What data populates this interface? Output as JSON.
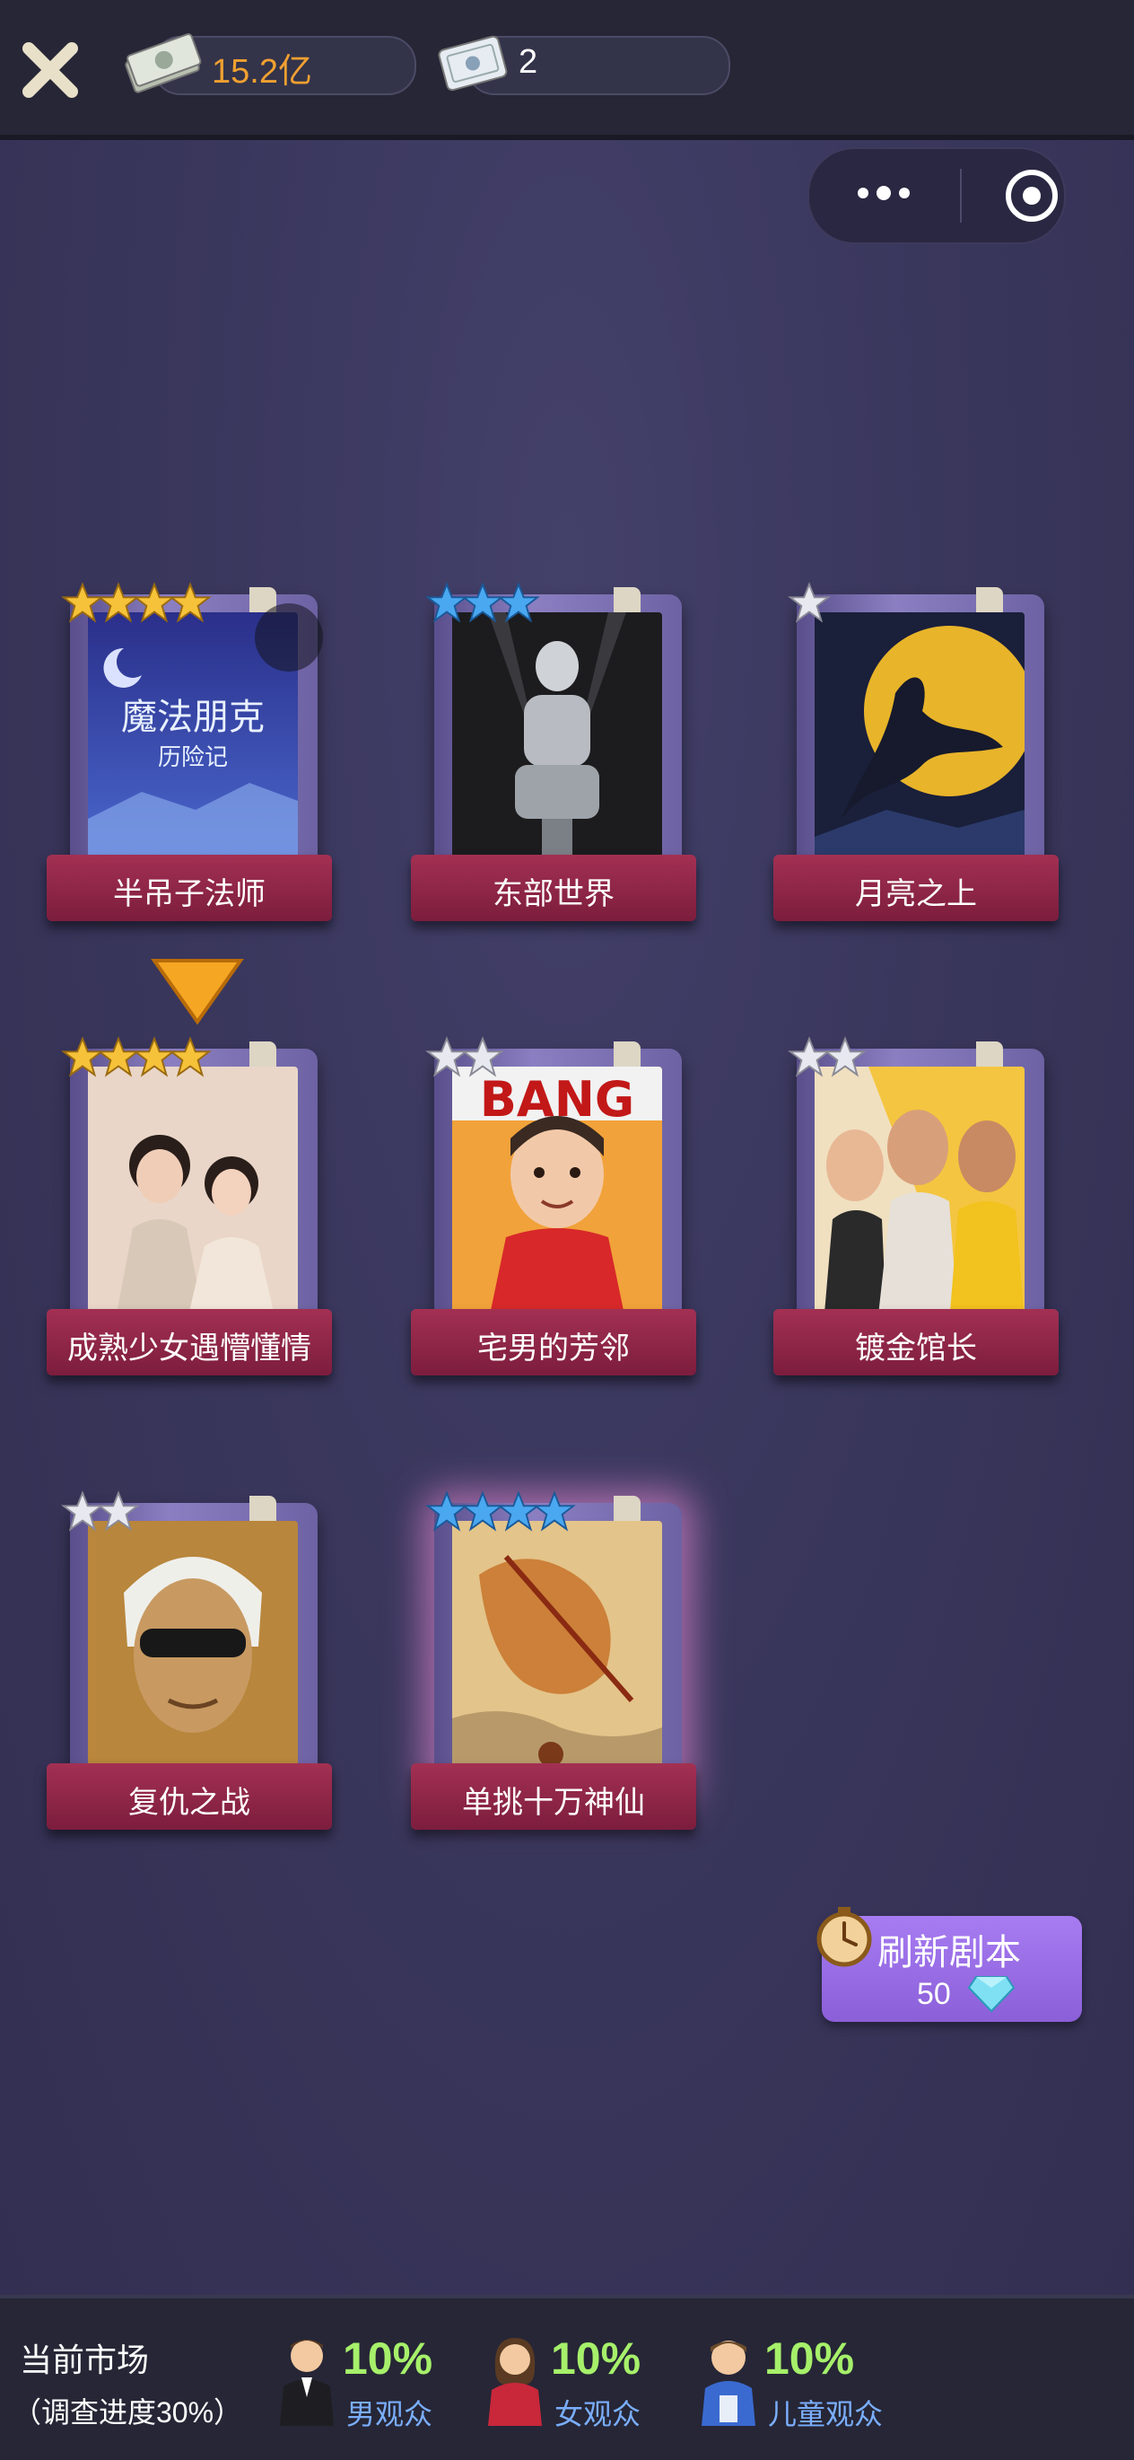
{
  "currency": {
    "money": "15.2亿",
    "tickets": "2"
  },
  "scripts": [
    {
      "title": "半吊子法师",
      "stars": 4,
      "star_color": "gold",
      "poster_text": "魔法朋克",
      "poster_sub": "历险记",
      "selected": true
    },
    {
      "title": "东部世界",
      "stars": 3,
      "star_color": "blue"
    },
    {
      "title": "月亮之上",
      "stars": 1,
      "star_color": "white"
    },
    {
      "title": "成熟少女遇懵懂情",
      "stars": 4,
      "star_color": "gold"
    },
    {
      "title": "宅男的芳邻",
      "stars": 2,
      "star_color": "white",
      "poster_text": "BANG"
    },
    {
      "title": "镀金馆长",
      "stars": 2,
      "star_color": "white"
    },
    {
      "title": "复仇之战",
      "stars": 2,
      "star_color": "white"
    },
    {
      "title": "单挑十万神仙",
      "stars": 4,
      "star_color": "blue",
      "highlighted": true
    }
  ],
  "refresh": {
    "label": "刷新剧本",
    "cost": "50"
  },
  "market": {
    "title": "当前市场",
    "progress": "（调查进度30%）",
    "audiences": [
      {
        "percent": "10%",
        "label": "男观众",
        "icon": "male-audience-icon"
      },
      {
        "percent": "10%",
        "label": "女观众",
        "icon": "female-audience-icon"
      },
      {
        "percent": "10%",
        "label": "儿童观众",
        "icon": "child-audience-icon"
      }
    ]
  },
  "colors": {
    "gold_star": "#f5c23a",
    "blue_star": "#4aa8f0",
    "white_star": "#e8e8f0",
    "money_text": "#f0a030",
    "percent_text": "#a6f06a",
    "audience_label": "#7aaefc"
  }
}
